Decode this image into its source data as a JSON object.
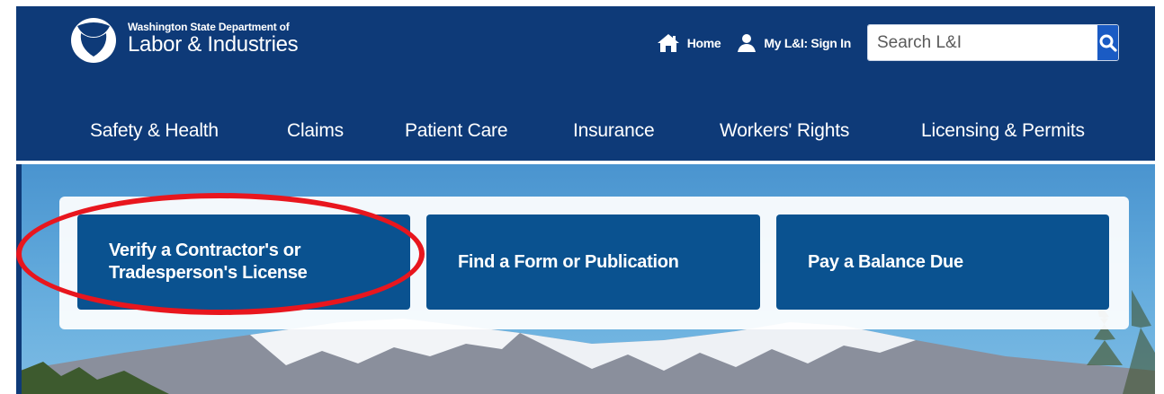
{
  "brand": {
    "agency_small": "Washington State Department of",
    "agency_big": "Labor & Industries",
    "colors": {
      "header": "#0e3a78",
      "tile": "#0a5290",
      "search_button": "#1a5bc4",
      "annotation": "#e8161e"
    }
  },
  "utility": {
    "home_label": "Home",
    "home_icon": "home-icon",
    "signin_label": "My L&I: Sign In",
    "signin_icon": "user-icon",
    "search_placeholder": "Search L&I",
    "search_icon": "search-icon"
  },
  "nav": {
    "items": [
      {
        "label": "Safety & Health"
      },
      {
        "label": "Claims"
      },
      {
        "label": "Patient Care"
      },
      {
        "label": "Insurance"
      },
      {
        "label": "Workers' Rights"
      },
      {
        "label": "Licensing & Permits"
      }
    ]
  },
  "tiles": {
    "verify_line1": "Verify a Contractor's or",
    "verify_line2": "Tradesperson's License",
    "form": "Find a Form or Publication",
    "balance": "Pay a Balance Due"
  }
}
